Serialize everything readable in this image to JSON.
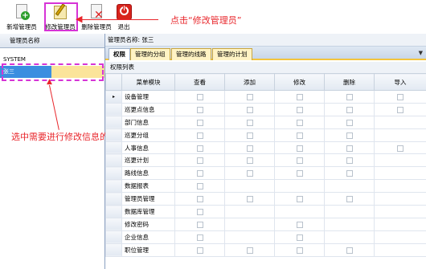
{
  "toolbar": {
    "buttons": [
      {
        "label": "新增管理员",
        "icon": "add-user-icon"
      },
      {
        "label": "修改管理员",
        "icon": "edit-icon"
      },
      {
        "label": "删除管理员",
        "icon": "delete-icon"
      },
      {
        "label": "退出",
        "icon": "power-icon"
      }
    ]
  },
  "annotations": {
    "click_edit": "点击“修改管理员”",
    "select_user": "选中需要进行修改信息的管理员",
    "color": "#e8262b",
    "highlight_color": "#d634d6"
  },
  "left_panel": {
    "header": "管理员名称",
    "rows": [
      "SYSTEM",
      "张三"
    ],
    "selected_index": 1
  },
  "right_panel": {
    "admin_name_label": "管理员名称: 张三",
    "tabs": [
      "权限",
      "管理的分组",
      "管理的线路",
      "管理的计划"
    ],
    "active_tab": 0,
    "subtitle": "权限列表",
    "columns": [
      "菜单模块",
      "查看",
      "添加",
      "修改",
      "删除",
      "导入"
    ],
    "rows": [
      {
        "module": "设备管理",
        "cb": [
          true,
          true,
          true,
          true,
          true
        ]
      },
      {
        "module": "巡更点信息",
        "cb": [
          true,
          true,
          true,
          true,
          true
        ]
      },
      {
        "module": "部门信息",
        "cb": [
          true,
          true,
          true,
          true,
          false
        ]
      },
      {
        "module": "巡更分组",
        "cb": [
          true,
          true,
          true,
          true,
          false
        ]
      },
      {
        "module": "人事信息",
        "cb": [
          true,
          true,
          true,
          true,
          true
        ]
      },
      {
        "module": "巡更计划",
        "cb": [
          true,
          true,
          true,
          true,
          false
        ]
      },
      {
        "module": "路线信息",
        "cb": [
          true,
          true,
          true,
          true,
          false
        ]
      },
      {
        "module": "数据报表",
        "cb": [
          true,
          false,
          false,
          false,
          false
        ]
      },
      {
        "module": "管理员管理",
        "cb": [
          true,
          true,
          true,
          true,
          false
        ]
      },
      {
        "module": "数据库管理",
        "cb": [
          true,
          false,
          false,
          false,
          false
        ]
      },
      {
        "module": "修改密码",
        "cb": [
          true,
          false,
          true,
          false,
          false
        ]
      },
      {
        "module": "企业信息",
        "cb": [
          true,
          false,
          true,
          false,
          false
        ]
      },
      {
        "module": "职位管理",
        "cb": [
          true,
          true,
          true,
          true,
          false
        ]
      }
    ]
  }
}
